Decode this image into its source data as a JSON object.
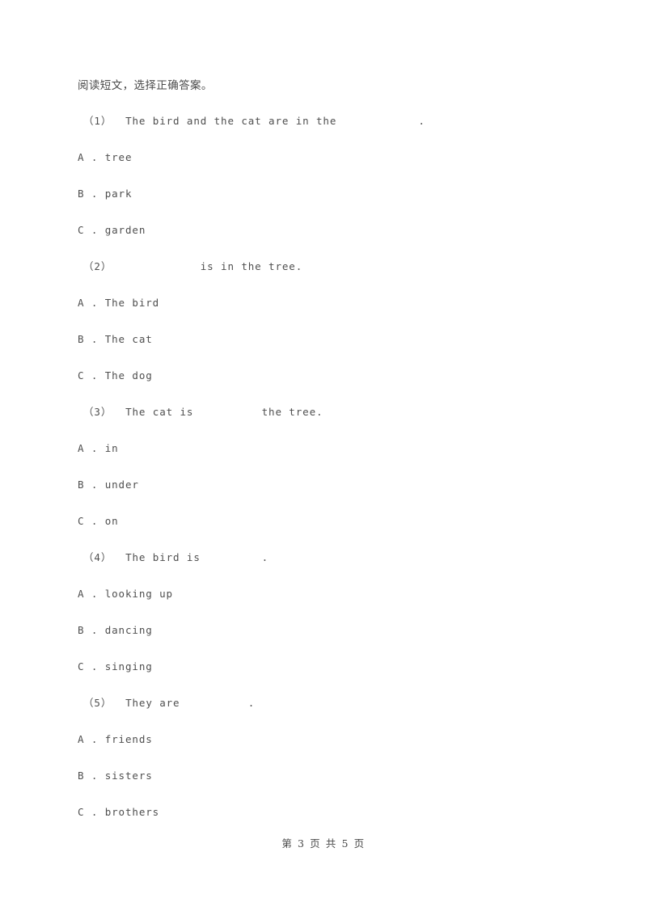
{
  "document": {
    "instruction": "阅读短文，选择正确答案。",
    "footer": "第 3 页 共 5 页"
  },
  "questions": [
    {
      "stem": "（1）  The bird and the cat are in the            .",
      "options": [
        {
          "label": "A . tree"
        },
        {
          "label": "B . park"
        },
        {
          "label": "C . garden"
        }
      ]
    },
    {
      "stem": "（2）             is in the tree.",
      "options": [
        {
          "label": "A . The bird"
        },
        {
          "label": "B . The cat"
        },
        {
          "label": "C . The dog"
        }
      ]
    },
    {
      "stem": "（3）  The cat is          the tree.",
      "options": [
        {
          "label": "A . in"
        },
        {
          "label": "B . under"
        },
        {
          "label": "C . on"
        }
      ]
    },
    {
      "stem": "（4）  The bird is         .",
      "options": [
        {
          "label": "A . looking up"
        },
        {
          "label": "B . dancing"
        },
        {
          "label": "C . singing"
        }
      ]
    },
    {
      "stem": "（5）  They are          .",
      "options": [
        {
          "label": "A . friends"
        },
        {
          "label": "B . sisters"
        },
        {
          "label": "C . brothers"
        }
      ]
    }
  ]
}
